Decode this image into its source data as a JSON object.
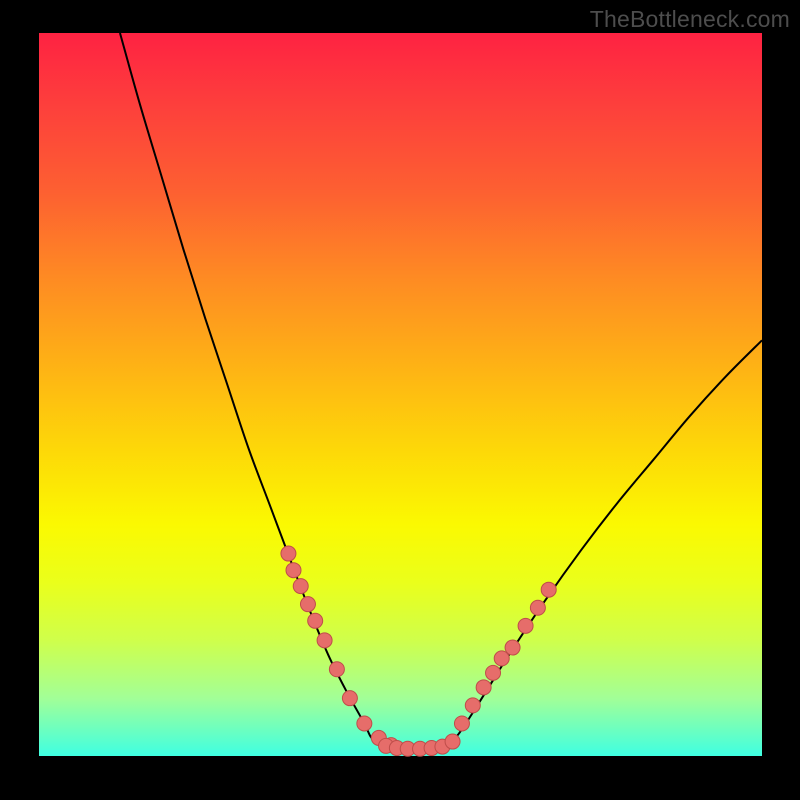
{
  "watermark": {
    "text": "TheBottleneck.com"
  },
  "colors": {
    "curve": "#000000",
    "dot_fill": "#e66d6a",
    "dot_stroke": "#bf4d4a"
  },
  "chart_data": {
    "type": "line",
    "title": "",
    "xlabel": "",
    "ylabel": "",
    "xlim": [
      0,
      100
    ],
    "ylim": [
      0,
      100
    ],
    "grid": false,
    "series": [
      {
        "name": "left-branch",
        "x": [
          11.2,
          14.0,
          17.0,
          20.0,
          23.0,
          26.0,
          29.0,
          32.0,
          35.0,
          37.5,
          40.0,
          42.5,
          45.0,
          46.0,
          47.5,
          49.0
        ],
        "values": [
          100,
          90.0,
          80.0,
          70.0,
          60.5,
          51.5,
          42.5,
          34.5,
          26.5,
          20.0,
          14.0,
          9.0,
          4.5,
          2.5,
          1.5,
          1.2
        ]
      },
      {
        "name": "plateau",
        "x": [
          49.0,
          51.0,
          53.0,
          55.0,
          56.5
        ],
        "values": [
          1.2,
          1.0,
          1.0,
          1.2,
          1.5
        ]
      },
      {
        "name": "right-branch",
        "x": [
          56.5,
          58.0,
          60.0,
          62.5,
          65.0,
          70.0,
          75.0,
          80.0,
          85.0,
          90.0,
          95.0,
          100.0
        ],
        "values": [
          1.5,
          3.0,
          6.0,
          10.0,
          14.0,
          21.5,
          28.5,
          35.0,
          41.0,
          47.0,
          52.5,
          57.5
        ]
      }
    ],
    "dots_left": {
      "name": "left-dots",
      "x": [
        34.5,
        35.2,
        36.2,
        37.2,
        38.2,
        39.5,
        41.2,
        43.0,
        45.0,
        47.0,
        48.7
      ],
      "values": [
        28.0,
        25.7,
        23.5,
        21.0,
        18.7,
        16.0,
        12.0,
        8.0,
        4.5,
        2.5,
        1.5
      ]
    },
    "dots_plateau": {
      "name": "plateau-dots",
      "x": [
        48.0,
        49.5,
        51.0,
        52.7,
        54.3,
        55.8,
        57.2
      ],
      "values": [
        1.4,
        1.1,
        1.0,
        1.0,
        1.1,
        1.3,
        2.0
      ]
    },
    "dots_right": {
      "name": "right-dots",
      "x": [
        58.5,
        60.0,
        61.5,
        62.8,
        64.0,
        65.5,
        67.3,
        69.0,
        70.5
      ],
      "values": [
        4.5,
        7.0,
        9.5,
        11.5,
        13.5,
        15.0,
        18.0,
        20.5,
        23.0
      ]
    }
  }
}
